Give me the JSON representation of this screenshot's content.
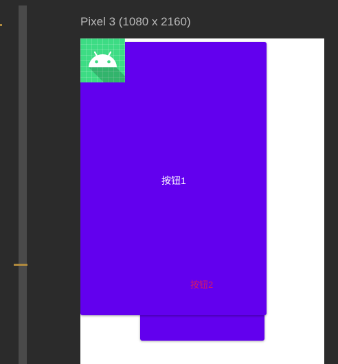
{
  "device": {
    "title": "Pixel 3 (1080 x 2160)"
  },
  "layout": {
    "button1": {
      "label": "按钮1"
    },
    "button2": {
      "label": "按钮2"
    }
  },
  "icons": {
    "app_icon": "android-icon"
  },
  "colors": {
    "ide_background": "#2b2b2b",
    "button_primary": "#6200ee",
    "button1_text": "#ffffff",
    "button2_text": "#d81b60",
    "icon_background": "#3ddc84",
    "screen_background": "#ffffff",
    "title_text": "#b9b9b9"
  }
}
